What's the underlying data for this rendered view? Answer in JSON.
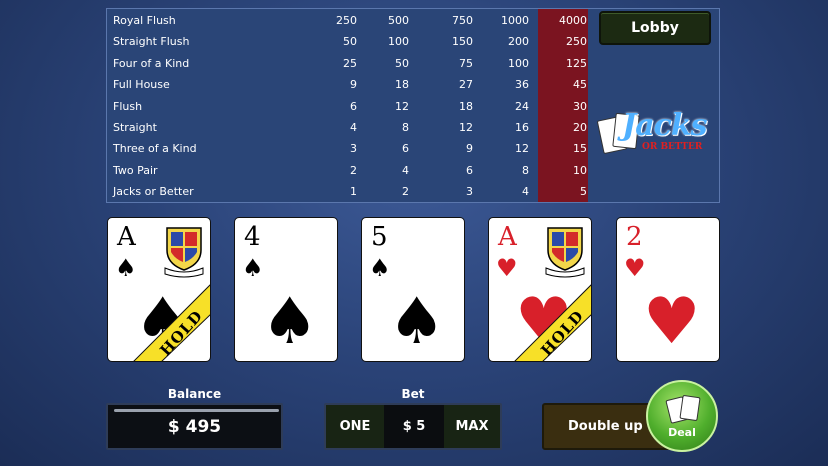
{
  "paytable": {
    "rows": [
      {
        "hand": "Royal Flush",
        "payouts": [
          "250",
          "500",
          "750",
          "1000",
          "4000"
        ]
      },
      {
        "hand": "Straight Flush",
        "payouts": [
          "50",
          "100",
          "150",
          "200",
          "250"
        ]
      },
      {
        "hand": "Four of a Kind",
        "payouts": [
          "25",
          "50",
          "75",
          "100",
          "125"
        ]
      },
      {
        "hand": "Full House",
        "payouts": [
          "9",
          "18",
          "27",
          "36",
          "45"
        ]
      },
      {
        "hand": "Flush",
        "payouts": [
          "6",
          "12",
          "18",
          "24",
          "30"
        ]
      },
      {
        "hand": "Straight",
        "payouts": [
          "4",
          "8",
          "12",
          "16",
          "20"
        ]
      },
      {
        "hand": "Three of a Kind",
        "payouts": [
          "3",
          "6",
          "9",
          "12",
          "15"
        ]
      },
      {
        "hand": "Two Pair",
        "payouts": [
          "2",
          "4",
          "6",
          "8",
          "10"
        ]
      },
      {
        "hand": "Jacks or Better",
        "payouts": [
          "1",
          "2",
          "3",
          "4",
          "5"
        ]
      }
    ],
    "highlight_color": "#7b1420"
  },
  "lobby": {
    "label": "Lobby"
  },
  "logo": {
    "title": "Jacks",
    "subtitle": "OR BETTER"
  },
  "cards": [
    {
      "rank": "A",
      "suit": "♠",
      "color": "black",
      "held": true,
      "hold_label": "HOLD"
    },
    {
      "rank": "4",
      "suit": "♠",
      "color": "black",
      "held": false,
      "hold_label": ""
    },
    {
      "rank": "5",
      "suit": "♠",
      "color": "black",
      "held": false,
      "hold_label": ""
    },
    {
      "rank": "A",
      "suit": "♥",
      "color": "red",
      "held": true,
      "hold_label": "HOLD"
    },
    {
      "rank": "2",
      "suit": "♥",
      "color": "red",
      "held": false,
      "hold_label": ""
    }
  ],
  "balance": {
    "label": "Balance",
    "value": "$ 495"
  },
  "bet": {
    "label": "Bet",
    "one_label": "ONE",
    "value": "$ 5",
    "max_label": "MAX"
  },
  "double_up": {
    "label": "Double up"
  },
  "deal": {
    "label": "Deal"
  },
  "icons": {
    "card_crest": "crest-icon",
    "hold_ribbon": "hold-ribbon-icon",
    "deal": "cards-icon"
  }
}
